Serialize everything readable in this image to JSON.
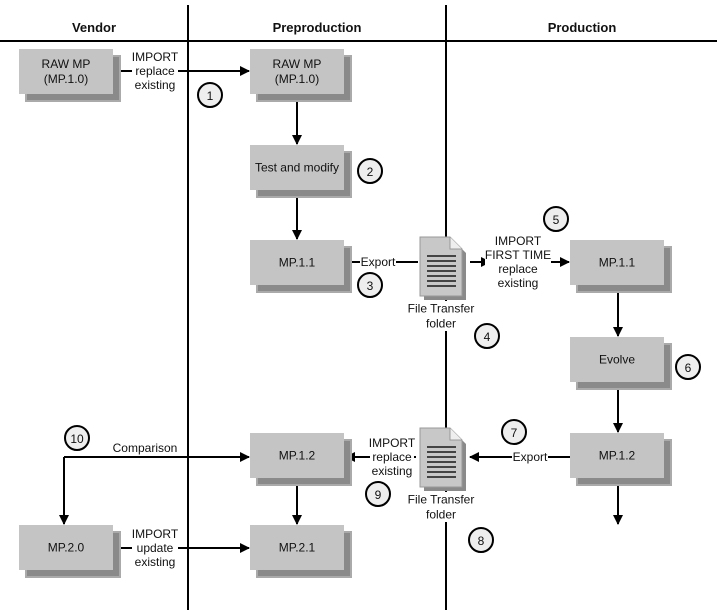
{
  "columns": [
    {
      "id": "vendor",
      "label": "Vendor"
    },
    {
      "id": "preproduction",
      "label": "Preproduction"
    },
    {
      "id": "production",
      "label": "Production"
    }
  ],
  "nodes": [
    {
      "id": "vendor-raw",
      "lines": [
        "RAW MP",
        "(MP.1.0)"
      ]
    },
    {
      "id": "pre-raw",
      "lines": [
        "RAW MP",
        "(MP.1.0)"
      ]
    },
    {
      "id": "pre-test",
      "lines": [
        "Test and modify"
      ]
    },
    {
      "id": "pre-mp11",
      "lines": [
        "MP.1.1"
      ]
    },
    {
      "id": "prod-mp11",
      "lines": [
        "MP.1.1"
      ]
    },
    {
      "id": "prod-evolve",
      "lines": [
        "Evolve"
      ]
    },
    {
      "id": "prod-mp12",
      "lines": [
        "MP.1.2"
      ]
    },
    {
      "id": "pre-mp12",
      "lines": [
        "MP.1.2"
      ]
    },
    {
      "id": "pre-mp21",
      "lines": [
        "MP.2.1"
      ]
    },
    {
      "id": "vendor-mp20",
      "lines": [
        "MP.2.0"
      ]
    }
  ],
  "files": [
    {
      "id": "file-1",
      "lines": [
        "File Transfer",
        "folder"
      ]
    },
    {
      "id": "file-2",
      "lines": [
        "File Transfer",
        "folder"
      ]
    }
  ],
  "edge_labels": [
    {
      "id": "import-1",
      "lines": [
        "IMPORT",
        "replace",
        "existing"
      ]
    },
    {
      "id": "export-1",
      "lines": [
        "Export"
      ]
    },
    {
      "id": "import-first",
      "lines": [
        "IMPORT",
        "FIRST TIME",
        "replace",
        "existing"
      ]
    },
    {
      "id": "export-2",
      "lines": [
        "Export"
      ]
    },
    {
      "id": "import-2",
      "lines": [
        "IMPORT",
        "replace",
        "existing"
      ]
    },
    {
      "id": "comparison",
      "lines": [
        "Comparison"
      ]
    },
    {
      "id": "import-update",
      "lines": [
        "IMPORT",
        "update",
        "existing"
      ]
    }
  ],
  "steps": [
    "1",
    "2",
    "3",
    "4",
    "5",
    "6",
    "7",
    "8",
    "9",
    "10"
  ],
  "colors": {
    "box": "#c4c4c4",
    "shadow": "#8a8a8a",
    "line": "#000000",
    "file": "#c8c8c8"
  }
}
